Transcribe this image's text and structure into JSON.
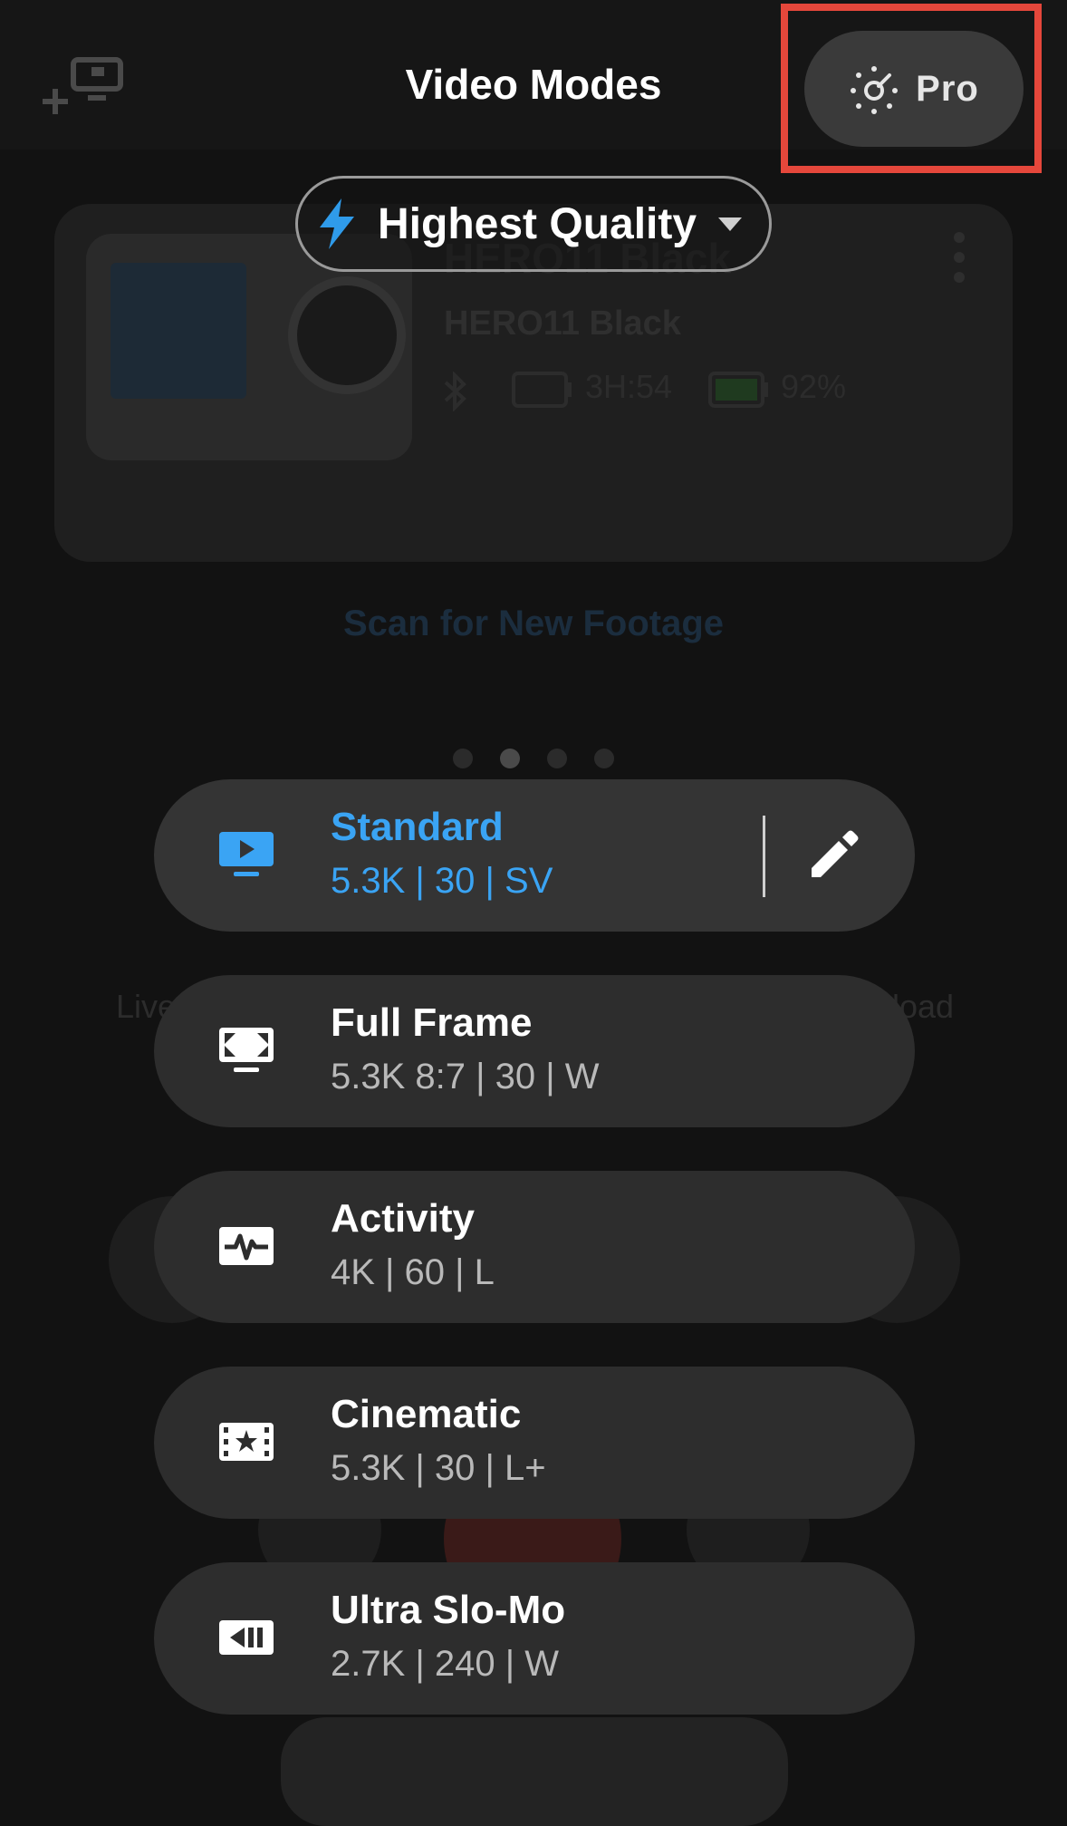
{
  "header": {
    "title": "Video Modes",
    "pro_label": "Pro"
  },
  "quality_selector": {
    "label": "Highest Quality"
  },
  "background": {
    "camera_name": "HERO11 Black",
    "camera_model": "HERO11 Black",
    "remaining_time": "3H:54",
    "battery": "92%",
    "scan_link": "Scan for New Footage",
    "live_label": "Live",
    "upload_label": "load",
    "page_dots": 4,
    "active_dot": 1
  },
  "modes": [
    {
      "name": "Standard",
      "spec": "5.3K | 30 | SV",
      "icon": "monitor-play-icon",
      "selected": true
    },
    {
      "name": "Full Frame",
      "spec": "5.3K 8:7 | 30 | W",
      "icon": "full-frame-icon",
      "selected": false
    },
    {
      "name": "Activity",
      "spec": "4K | 60 | L",
      "icon": "activity-pulse-icon",
      "selected": false
    },
    {
      "name": "Cinematic",
      "spec": "5.3K | 30 | L+",
      "icon": "film-star-icon",
      "selected": false
    },
    {
      "name": "Ultra Slo-Mo",
      "spec": "2.7K | 240 | W",
      "icon": "slow-motion-icon",
      "selected": false
    }
  ],
  "colors": {
    "accent_blue": "#3aa4f4",
    "highlight_red": "#e5473b",
    "lightning_blue": "#2f9bea"
  }
}
